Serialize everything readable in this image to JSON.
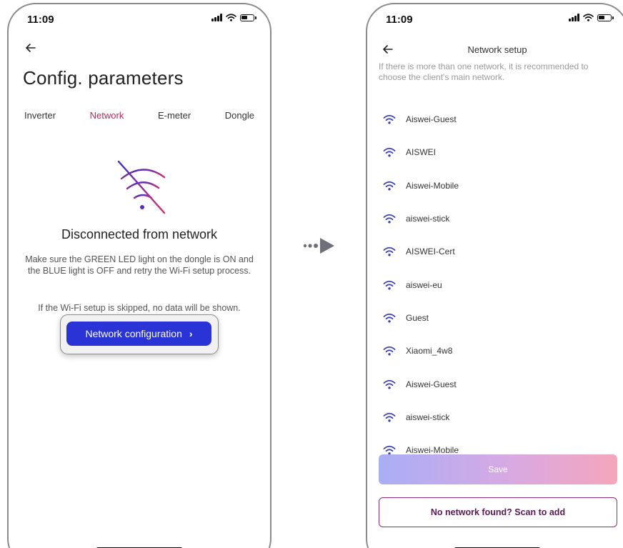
{
  "left_screen": {
    "status": {
      "time": "11:09"
    },
    "title": "Config. parameters",
    "tabs": [
      {
        "label": "Inverter",
        "active": false
      },
      {
        "label": "Network",
        "active": true
      },
      {
        "label": "E-meter",
        "active": false
      },
      {
        "label": "Dongle",
        "active": false
      }
    ],
    "disconnected_title": "Disconnected from network",
    "description": "Make sure the GREEN LED light on the dongle is ON and the BLUE light is OFF and retry the Wi-Fi setup process.",
    "skip_note": "If the Wi-Fi setup is skipped, no data will be shown.",
    "config_button": "Network configuration",
    "icons": {
      "back": "arrow-left-icon",
      "no_wifi": "wifi-off-icon",
      "chevron": "chevron-right-icon"
    }
  },
  "right_screen": {
    "status": {
      "time": "11:09"
    },
    "title": "Network setup",
    "hint": "If there is more than one network, it is recommended to choose the client's main network.",
    "networks": [
      "Aiswei-Guest",
      "AISWEI",
      "Aiswei-Mobile",
      "aiswei-stick",
      "AISWEI-Cert",
      "aiswei-eu",
      "Guest",
      "Xiaomi_4w8",
      "Aiswei-Guest",
      "aiswei-stick",
      "Aiswei-Mobile"
    ],
    "save_button": "Save",
    "scan_button": "No network found? Scan to add"
  },
  "colors": {
    "accent_pink": "#c4235e",
    "primary_blue": "#2a34d6",
    "wifi_icon": "#3b3fb8",
    "scan_border": "#8e2e7a"
  }
}
